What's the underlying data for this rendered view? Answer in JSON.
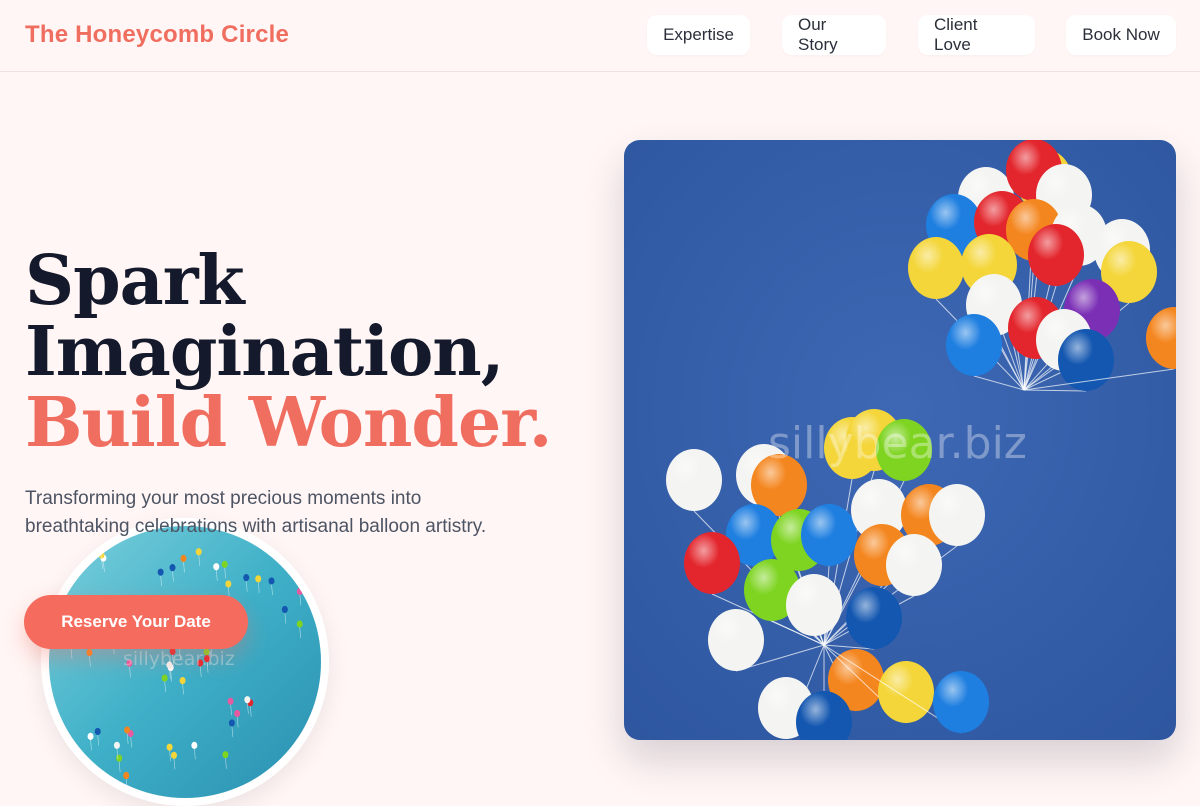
{
  "nav": {
    "brand": "The Honeycomb Circle",
    "items": [
      {
        "label": "Expertise"
      },
      {
        "label": "Our Story"
      },
      {
        "label": "Client Love"
      },
      {
        "label": "Book Now"
      }
    ]
  },
  "hero": {
    "title_line1": "Spark",
    "title_line2": "Imagination,",
    "title_accent": "Build Wonder.",
    "subtitle": "Transforming your most precious moments into breathtaking celebrations with artisanal balloon artistry.",
    "cta_label": "Reserve Your Date"
  },
  "images": {
    "main_watermark": "sillybear.biz",
    "circle_watermark": "sillybear.biz"
  },
  "colors": {
    "accent": "#f06e60",
    "background": "#fff6f5",
    "heading": "#141a2b"
  }
}
